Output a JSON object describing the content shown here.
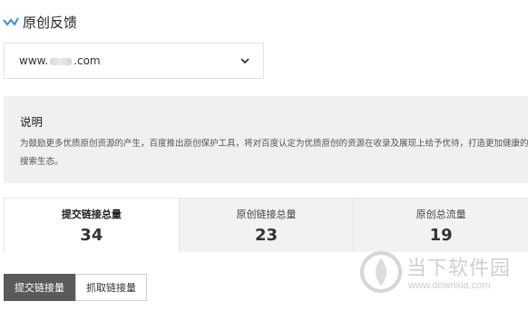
{
  "header": {
    "title": "原创反馈"
  },
  "domain_select": {
    "value_prefix": "www.",
    "value_suffix": ".com"
  },
  "description": {
    "title": "说明",
    "text": "为鼓励更多优质原创资源的产生，百度推出原创保护工具，将对百度认定为优质原创的资源在收录及展现上给予优待，打造更加健康的搜索生态。"
  },
  "stats": [
    {
      "label": "提交链接总量",
      "value": "34",
      "active": true
    },
    {
      "label": "原创链接总量",
      "value": "23",
      "active": false
    },
    {
      "label": "原创总流量",
      "value": "19",
      "active": false
    }
  ],
  "tabs": [
    {
      "label": "提交链接量",
      "active": true
    },
    {
      "label": "抓取链接量",
      "active": false
    }
  ],
  "watermark": {
    "text": "当下软件园",
    "url": "www.downxia.com"
  },
  "colors": {
    "accent": "#3a8ee6",
    "tab_active": "#5a5a5a",
    "panel_bg": "#f0f0f0"
  }
}
